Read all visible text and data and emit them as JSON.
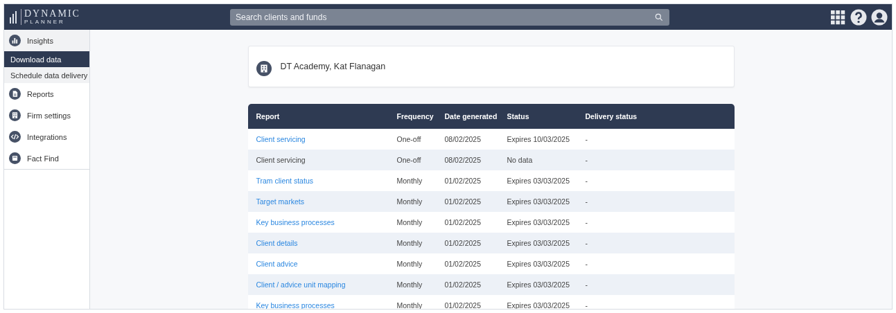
{
  "header": {
    "logo_word": "DYNAMIC",
    "logo_sub": "PLANNER",
    "search": {
      "placeholder": "Search clients and funds"
    }
  },
  "sidebar": {
    "items": [
      {
        "label": "Insights",
        "expanded": true,
        "children": [
          {
            "label": "Download data",
            "selected": true
          },
          {
            "label": "Schedule data delivery",
            "selected": false
          }
        ]
      },
      {
        "label": "Reports",
        "expanded": false
      },
      {
        "label": "Firm settings",
        "expanded": false
      },
      {
        "label": "Integrations",
        "expanded": false
      },
      {
        "label": "Fact Find",
        "expanded": false
      }
    ]
  },
  "client_card": {
    "title": "DT Academy, Kat Flanagan"
  },
  "table": {
    "columns": [
      "Report",
      "Frequency",
      "Date generated",
      "Status",
      "Delivery status"
    ],
    "rows": [
      {
        "report": "Client servicing",
        "link": true,
        "frequency": "One-off",
        "date": "08/02/2025",
        "status": "Expires 10/03/2025",
        "delivery": "-"
      },
      {
        "report": "Client servicing",
        "link": false,
        "frequency": "One-off",
        "date": "08/02/2025",
        "status": "No data",
        "delivery": "-"
      },
      {
        "report": "Tram client status",
        "link": true,
        "frequency": "Monthly",
        "date": "01/02/2025",
        "status": "Expires 03/03/2025",
        "delivery": "-"
      },
      {
        "report": "Target markets",
        "link": true,
        "frequency": "Monthly",
        "date": "01/02/2025",
        "status": "Expires 03/03/2025",
        "delivery": "-"
      },
      {
        "report": "Key business processes",
        "link": true,
        "frequency": "Monthly",
        "date": "01/02/2025",
        "status": "Expires 03/03/2025",
        "delivery": "-"
      },
      {
        "report": "Client details",
        "link": true,
        "frequency": "Monthly",
        "date": "01/02/2025",
        "status": "Expires 03/03/2025",
        "delivery": "-"
      },
      {
        "report": "Client advice",
        "link": true,
        "frequency": "Monthly",
        "date": "01/02/2025",
        "status": "Expires 03/03/2025",
        "delivery": "-"
      },
      {
        "report": "Client / advice unit mapping",
        "link": true,
        "frequency": "Monthly",
        "date": "01/02/2025",
        "status": "Expires 03/03/2025",
        "delivery": "-"
      },
      {
        "report": "Key business processes",
        "link": true,
        "frequency": "Monthly",
        "date": "01/02/2025",
        "status": "Expires 03/03/2025",
        "delivery": "-"
      }
    ]
  }
}
